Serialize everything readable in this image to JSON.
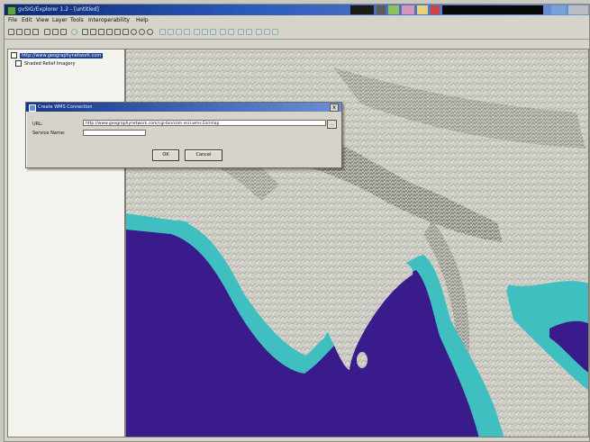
{
  "window": {
    "title": "gvSIG/Explorer 1.2 - [untitled]"
  },
  "menu": {
    "items": [
      "File",
      "Edit",
      "View",
      "Layer",
      "Tools",
      "Interoperability",
      "Help"
    ]
  },
  "toolbar": {
    "icons": [
      "open-icon",
      "save-icon",
      "print-icon",
      "layers-icon",
      "add-layer-icon",
      "zoom-in-icon",
      "zoom-out-icon",
      "pan-icon",
      "identify-icon",
      "measure-icon",
      "search-icon",
      "refresh-icon"
    ]
  },
  "layers": {
    "items": [
      {
        "label": "http://www.geographynetwork.com",
        "checked": true,
        "selected": true
      },
      {
        "label": "Shaded Relief Imagery",
        "checked": true,
        "selected": false
      }
    ]
  },
  "dialog": {
    "title": "Create WMS Connection",
    "close_label": "x",
    "url_label": "URL:",
    "url_value": "http://www.geographynetwork.com/cgi-bin/com.esri.wms.Esrimap",
    "name_label": "Service Name:",
    "name_value": "",
    "browse_label": "...",
    "ok_label": "OK",
    "cancel_label": "Cancel"
  },
  "colors": {
    "ocean_deep": "#3a1b8c",
    "ocean_shelf": "#3fbfbf",
    "terrain": "#cfcfc8"
  }
}
